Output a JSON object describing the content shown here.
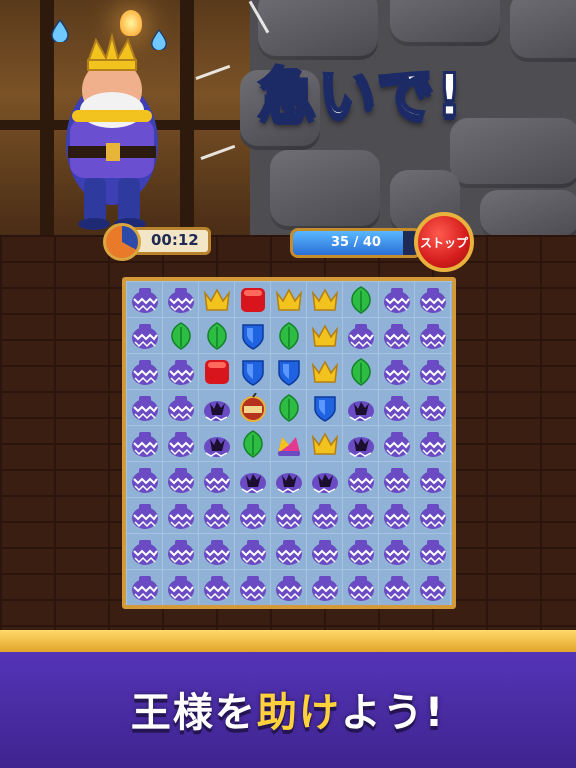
{
  "banner": {
    "headline": "急いで!"
  },
  "hud": {
    "timer": "00:12",
    "timer_remaining_fraction": 0.33,
    "moves_text": "35 / 40",
    "moves_done": 35,
    "moves_total": 40,
    "stop_label": "ストップ"
  },
  "board": {
    "cols": 9,
    "rows": 9,
    "legend": {
      "V": "vase",
      "C": "crown",
      "R": "red-cube",
      "L": "green-leaf",
      "S": "blue-shield",
      "B": "broken-vase",
      "T": "tnt-bomb",
      "J": "jester-hat"
    },
    "cells": [
      "VVCRCCLVV",
      "VLLSLCVVV",
      "VVRSSCLVV",
      "VVBTLSBVV",
      "VVBLJCBVV",
      "VVVBBBVVV",
      "VVVVVVVVV",
      "VVVVVVVVV",
      "VVVVVVVVV"
    ]
  },
  "footer": {
    "tagline_part1": "王様を",
    "tagline_part2": "助け",
    "tagline_part3": "よう!"
  },
  "colors": {
    "vase": "#6a4bc4",
    "crown": "#f2c21e",
    "red": "#d8151d",
    "leaf": "#2ebd43",
    "shield": "#1f63e0"
  }
}
